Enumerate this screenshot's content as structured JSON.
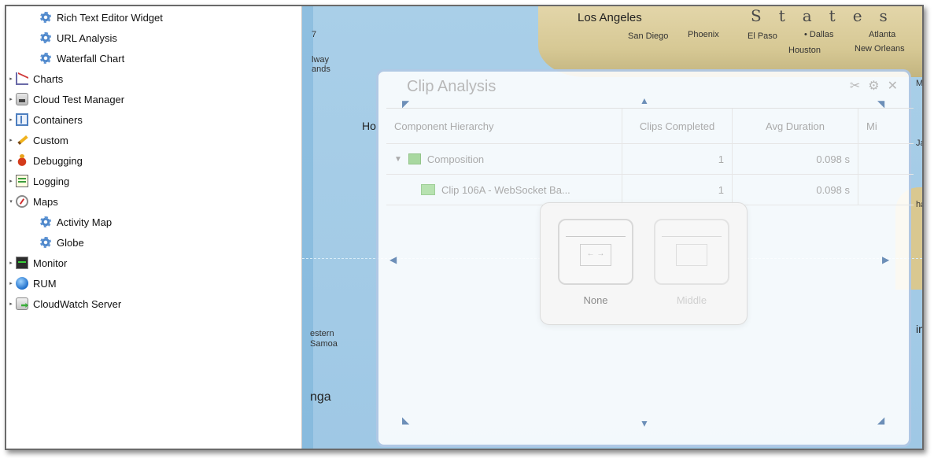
{
  "sidebar": {
    "items": [
      {
        "label": "Rich Text Editor Widget",
        "icon": "gear-icon",
        "expander": ""
      },
      {
        "label": "URL Analysis",
        "icon": "gear-icon",
        "expander": ""
      },
      {
        "label": "Waterfall Chart",
        "icon": "gear-icon",
        "expander": ""
      },
      {
        "label": "Charts",
        "icon": "chart-icon",
        "expander": "▸"
      },
      {
        "label": "Cloud Test Manager",
        "icon": "cloud-test-icon",
        "expander": "▸"
      },
      {
        "label": "Containers",
        "icon": "containers-icon",
        "expander": "▸"
      },
      {
        "label": "Custom",
        "icon": "pen-icon",
        "expander": "▸"
      },
      {
        "label": "Debugging",
        "icon": "bug-icon",
        "expander": "▸"
      },
      {
        "label": "Logging",
        "icon": "log-icon",
        "expander": "▸"
      },
      {
        "label": "Maps",
        "icon": "compass-icon",
        "expander": "▾"
      },
      {
        "label": "Activity Map",
        "icon": "gear-icon",
        "expander": ""
      },
      {
        "label": "Globe",
        "icon": "gear-icon",
        "expander": ""
      },
      {
        "label": "Monitor",
        "icon": "monitor-icon",
        "expander": "▸"
      },
      {
        "label": "RUM",
        "icon": "globe-icon",
        "expander": "▸"
      },
      {
        "label": "CloudWatch Server",
        "icon": "database-icon",
        "expander": "▸"
      }
    ]
  },
  "map": {
    "labels": {
      "los_angeles": "Los Angeles",
      "states": "States",
      "san_diego": "San Diego",
      "phoenix": "Phoenix",
      "el_paso": "El Paso",
      "dallas": "• Dallas",
      "atlanta": "Atlanta",
      "houston": "Houston",
      "new_orleans": "New Orleans",
      "way": "lway",
      "ands": "ands",
      "ho": "Ho",
      "western": "estern",
      "samoa": "Samoa",
      "nga": "nga",
      "seven": "7",
      "m": "M",
      "j": "Ja",
      "hi": "ha",
      "im": "im"
    }
  },
  "widget": {
    "title": "Clip Analysis",
    "columns": [
      "Component Hierarchy",
      "Clips Completed",
      "Avg Duration",
      "Mi"
    ],
    "rows": [
      {
        "name": "Composition",
        "clips": "1",
        "avg": "0.098 s"
      },
      {
        "name": "Clip 106A - WebSocket Ba...",
        "clips": "1",
        "avg": "0.098 s"
      }
    ],
    "layout_options": [
      {
        "label": "None",
        "glyph": "← →"
      },
      {
        "label": "Middle",
        "glyph": ""
      }
    ]
  }
}
